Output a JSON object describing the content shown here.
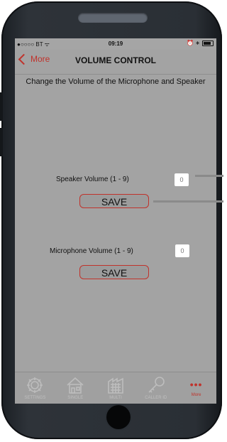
{
  "status_bar": {
    "carrier": "●○○○○ BT ᯤ",
    "time": "09:19",
    "right": "⏰ ∗"
  },
  "nav": {
    "back_label": "More",
    "title": "VOLUME CONTROL"
  },
  "description": "Change the Volume of the Microphone and Speaker",
  "speaker": {
    "label": "Speaker Volume (1 - 9)",
    "value": "0",
    "save_label": "SAVE"
  },
  "microphone": {
    "label": "Microphone Volume (1 - 9)",
    "value": "0",
    "save_label": "SAVE"
  },
  "tabs": [
    {
      "label": "SETTINGS",
      "icon": "gear-icon"
    },
    {
      "label": "SINGLE",
      "icon": "house-icon"
    },
    {
      "label": "MULTI",
      "icon": "building-icon"
    },
    {
      "label": "CALLER ID",
      "icon": "key-icon"
    },
    {
      "label": "More",
      "icon": "more-dots-icon",
      "active": true
    }
  ],
  "colors": {
    "accent": "#c0322b",
    "screen_bg": "#a3a3a3",
    "frame": "#2a2f35"
  }
}
